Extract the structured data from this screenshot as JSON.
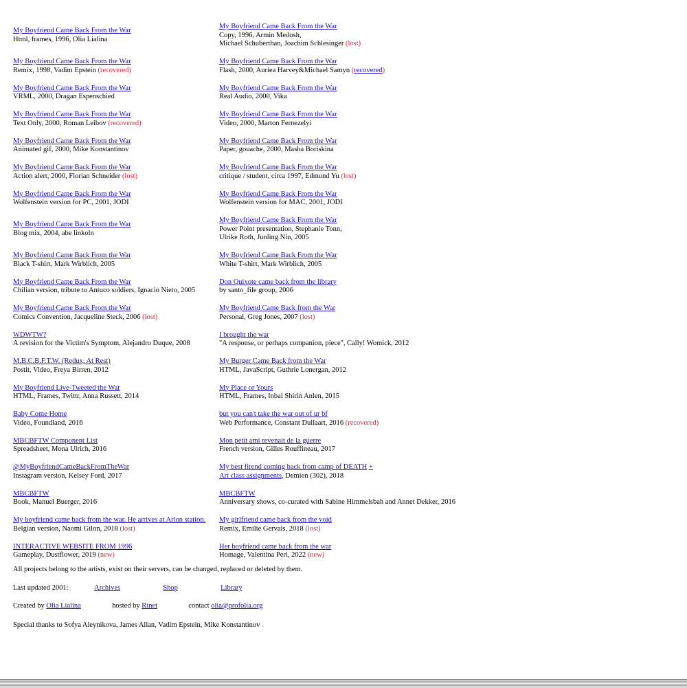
{
  "rows": [
    [
      {
        "title": "My Boyfriend Came Back From the War",
        "lines": [
          {
            "text": "Html, frames, 1996, Olia Lialina",
            "status": ""
          }
        ]
      },
      {
        "title": "My Boyfriend Came Back From the War",
        "lines": [
          {
            "text": "Copy, 1996, Armin Medosh,",
            "status": ""
          },
          {
            "text": "Michael Schuberthan, Joachim Schlesinger",
            "status": "(lost)"
          }
        ]
      }
    ],
    [
      {
        "title": "My Boyfriend Came Back From the War",
        "lines": [
          {
            "text": "Remix, 1998, Vadim Epstein",
            "status": "(recovered)"
          }
        ]
      },
      {
        "title": "My Boyfriend Came Back From the War",
        "lines": [
          {
            "text": "Flash, 2000, Auriea Harvey&Michael Samyn",
            "status": "(recovered)",
            "status_link": true
          }
        ]
      }
    ],
    [
      {
        "title": "My Boyfriend Came Back From the War",
        "lines": [
          {
            "text": "VRML, 2000, Dragan Espenschied",
            "status": ""
          }
        ]
      },
      {
        "title": "My Boyfriend Came Back From the War",
        "lines": [
          {
            "text": "Real Audio, 2000, Vika",
            "status": ""
          }
        ]
      }
    ],
    [
      {
        "title": "My Boyfriend Came Back From the War",
        "lines": [
          {
            "text": "Text Only, 2000, Roman Leibov",
            "status": "(recovered)"
          }
        ]
      },
      {
        "title": "My Boyfriend Came Back From the War",
        "lines": [
          {
            "text": "Video, 2000, Marton Fernezelyi",
            "status": ""
          }
        ]
      }
    ],
    [
      {
        "title": "My Boyfriend Came Back From the War",
        "lines": [
          {
            "text": "Animated gif, 2000, Mike Konstantinov",
            "status": ""
          }
        ]
      },
      {
        "title": "My Boyfriend Came Back From the War",
        "lines": [
          {
            "text": "Paper, gouache, 2000, Masha Boriskina",
            "status": ""
          }
        ]
      }
    ],
    [
      {
        "title": "My Boyfriend Came Back From the War",
        "lines": [
          {
            "text": "Action alert, 2000, Florian Schneider",
            "status": "(lost)"
          }
        ]
      },
      {
        "title": "My Boyfriend Came Back From the War",
        "lines": [
          {
            "text": "critique / student, circa 1997, Edmund Yu",
            "status": "(lost)"
          }
        ]
      }
    ],
    [
      {
        "title": "My Boyfriend Came Back From the War",
        "lines": [
          {
            "text": "Wolfenstein version for PC, 2001, JODI",
            "status": ""
          }
        ]
      },
      {
        "title": "My Boyfriend Came Back From the War",
        "lines": [
          {
            "text": "Wolfenstein version for MAC, 2001, JODI",
            "status": ""
          }
        ]
      }
    ],
    [
      {
        "title": "My Boyfriend Came Back From the War",
        "lines": [
          {
            "text": "Blog mix, 2004, abe linkoln",
            "status": ""
          }
        ]
      },
      {
        "title": "My Boyfriend Came Back From the War",
        "lines": [
          {
            "text": "Power Point presentation, Stephanie Tonn,",
            "status": ""
          },
          {
            "text": "Ulrike Roth, Junling Niu, 2005",
            "status": ""
          }
        ]
      }
    ],
    [
      {
        "title": "My Boyfriend Came Back From the War",
        "lines": [
          {
            "text": "Black T-shirt, Mark Wirblich, 2005",
            "status": ""
          }
        ]
      },
      {
        "title": "My Boyfriend Came Back From the War",
        "lines": [
          {
            "text": "White T-shirt, Mark Wirblich, 2005",
            "status": ""
          }
        ]
      }
    ],
    [
      {
        "title": "My Boyfriend Came Back From the War",
        "lines": [
          {
            "text": "Chilian version, tribute to Antuco soldiers, Ignacio Nieto, 2005",
            "status": ""
          }
        ]
      },
      {
        "title": "Don Quixote came back from the library",
        "lines": [
          {
            "text": "by santo_file group, 2006",
            "status": ""
          }
        ]
      }
    ],
    [
      {
        "title": "My Boyfriend Came Back From the War",
        "lines": [
          {
            "text": "Comics Convention, Jacqueline Steck, 2006",
            "status": "(lost)"
          }
        ]
      },
      {
        "title": "My Boyfriend Came Back from the War",
        "lines": [
          {
            "text": "Personal, Greg Jones, 2007",
            "status": "(lost)"
          }
        ]
      }
    ],
    [
      {
        "title": "WDWTW?",
        "lines": [
          {
            "text": "A revision for the Victim's Symptom, Alejandro Duque, 2008",
            "status": ""
          }
        ]
      },
      {
        "title": "I brought the war",
        "lines": [
          {
            "text": "\"A response, or perhaps companion, piece\", Cally! Womick, 2012",
            "status": ""
          }
        ]
      }
    ],
    [
      {
        "title": "M.B.C.B.F.T.W. (Redux, At Rest)",
        "lines": [
          {
            "text": "Postit, Video, Freya Birren, 2012",
            "status": ""
          }
        ]
      },
      {
        "title": "My Burger Came Back from the War",
        "lines": [
          {
            "text": "HTML, JavaScript, Guthrie Lonergan, 2012",
            "status": ""
          }
        ]
      }
    ],
    [
      {
        "title": "My Boyfriend Live-Tweeted the War",
        "lines": [
          {
            "text": "HTML, Frames, Twittr, Anna Russett, 2014",
            "status": ""
          }
        ]
      },
      {
        "title": "My Place or Yours",
        "lines": [
          {
            "text": "HTML, Frames, Inbal Shirin Anlen, 2015",
            "status": ""
          }
        ]
      }
    ],
    [
      {
        "title": "Baby Come Home",
        "lines": [
          {
            "text": "Video, Foundland, 2016",
            "status": ""
          }
        ]
      },
      {
        "title": "but you can't take the war out of ur bf",
        "lines": [
          {
            "text": "Web Performance, Constant Dullaart, 2016",
            "status": "(recovered)"
          }
        ]
      }
    ],
    [
      {
        "title": "MBCBFTW Component List",
        "lines": [
          {
            "text": "Spreadsheet, Mona Ulrich, 2016",
            "status": ""
          }
        ]
      },
      {
        "title": "Mon petit ami revenait de la guerre",
        "lines": [
          {
            "text": "French version, Gilles Rouffineau, 2017",
            "status": ""
          }
        ]
      }
    ],
    [
      {
        "title": "@MyBoyfriendCameBackFromTheWar",
        "lines": [
          {
            "text": "Instagram version, Kelsey Ford, 2017",
            "status": ""
          }
        ]
      },
      {
        "title": "My best firend coming back from camp of DEATH",
        "title_plus": "+",
        "lines": [
          {
            "text": ", Demien (302), 2018",
            "status": "",
            "prefix_link": "Art class assignments"
          }
        ]
      }
    ],
    [
      {
        "title": "MBCBFTW",
        "lines": [
          {
            "text": "Book, Manuel Buerger, 2016",
            "status": ""
          }
        ]
      },
      {
        "title": "MBCBFTW",
        "lines": [
          {
            "text": "Anniversary shows, co-curated with Sabine Himmelsbah and Annet Dekker, 2016",
            "status": ""
          }
        ]
      }
    ],
    [
      {
        "title": "My boyfriend came back from the war. He arrives at Arlon station.",
        "lines": [
          {
            "text": "Belgian version, Naomi Gilon, 2018",
            "status": "(lost)"
          }
        ]
      },
      {
        "title": "My girlfriend came back from the void",
        "lines": [
          {
            "text": "Remix, Emilie Gervais, 2018",
            "status": "(lost)"
          }
        ]
      }
    ],
    [
      {
        "title": "INTERACTIVE WEBSITE FROM 1996",
        "lines": [
          {
            "text": "Gameplay, Dustflower, 2019",
            "status": "(new)"
          }
        ]
      },
      {
        "title": "Her boyfriend came back from the war",
        "lines": [
          {
            "text": "Homage, Valentina Peri, 2022",
            "status": "(new)"
          }
        ]
      }
    ]
  ],
  "footer": {
    "disclaimer": "All projects belong to the artists, exist on their servers, can be changed, replaced or deleted by them.",
    "last_updated": "Last updated 2001:",
    "archives": "Archives",
    "shop": "Shop",
    "library": "Library",
    "created_by": "Created by",
    "author": "Olia Lialina",
    "hosted_by": "hosted by",
    "host": "Rinet",
    "contact": "contact",
    "email": "olia@profolia.org",
    "thanks": "Special thanks to Sofya Aleynikova, James Allan, Vadim Epstein, Mike Konstantinov",
    "thanks_end": "."
  },
  "colors": {
    "link": "#1a0dab",
    "status": "#e0203a",
    "text": "#000000"
  }
}
